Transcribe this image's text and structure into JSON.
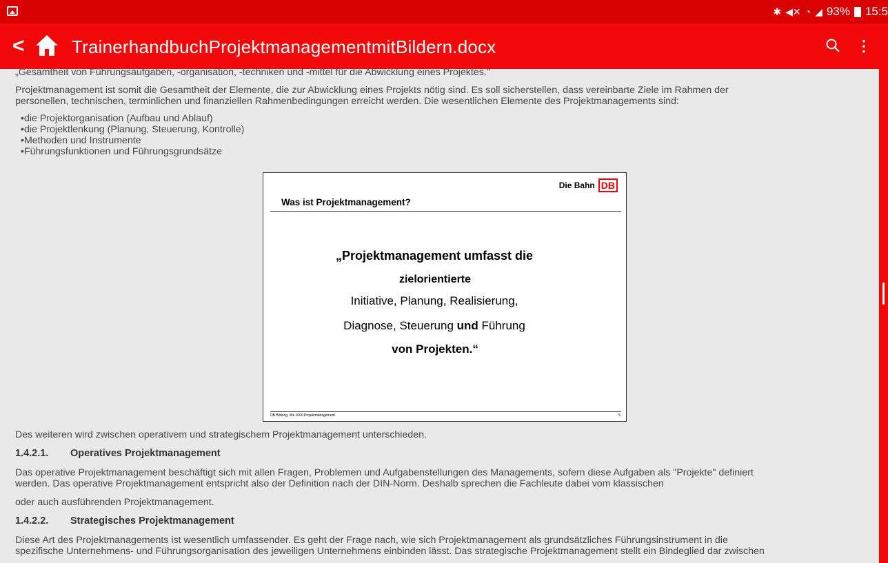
{
  "status_bar": {
    "icons": [
      "bluetooth-icon",
      "mute-icon",
      "wifi-icon",
      "signal-icon"
    ],
    "battery": "93%",
    "time": "15:5"
  },
  "app_bar": {
    "back_icon": "chevron-left-icon",
    "home_icon": "home-icon",
    "title": "TrainerhandbuchProjektmanagementmitBildern.docx",
    "search_icon": "search-icon",
    "more_icon": "more-vert-icon"
  },
  "document": {
    "p0": "„Gesamtheit von Führungsaufgaben, -organisation, -techniken und -mittel für die Abwicklung eines Projektes.\"",
    "p1_line1": "Projektmanagement ist somit die Gesamtheit der Elemente, die zur Abwicklung eines Projekts nötig sind. Es soll sicherstellen, dass vereinbarte Ziele im Rahmen der",
    "p1_line2": "personellen, technischen, terminlichen und finanziellen Rahmenbedingungen erreicht werden. Die wesentlichen Elemente des Projektmanagements sind:",
    "bullets": [
      "•die Projektorganisation (Aufbau und Ablauf)",
      "•die Projektlenkung (Planung, Steuerung, Kontrolle)",
      "•Methoden und Instrumente",
      "•Führungsfunktionen und Führungsgrundsätze"
    ],
    "p2": "Des weiteren wird zwischen operativem und strategischem Projektmanagement unterschieden.",
    "h1_num": "1.4.2.1.",
    "h1_text": "Operatives Projektmanagement",
    "p3_line1": "Das operative Projektmanagement beschäftigt sich mit allen Fragen, Problemen und Aufgabenstellungen des Managements, sofern diese Aufgaben als \"Projekte\" definiert",
    "p3_line2": "werden. Das operative Projektmanagement entspricht also der Definition nach der DIN-Norm. Deshalb sprechen die Fachleute dabei vom klassischen",
    "p4": "oder auch ausführenden Projektmanagement.",
    "h2_num": "1.4.2.2.",
    "h2_text": "Strategisches Projektmanagement",
    "p5_line1": "Diese Art des Projektmanagements ist wesentlich umfassender. Es geht der Frage nach, wie sich Projektmanagement als grundsätzliches Führungsinstrument in die",
    "p5_line2": "spezifische Unternehmens- und Führungsorganisation des jeweiligen Unternehmens einbinden lässt. Das strategische Projektmanagement stellt ein Bindeglied dar zwischen"
  },
  "slide": {
    "brand": "Die Bahn",
    "logo": "DB",
    "title": "Was ist Projektmanagement?",
    "q1": "„Projektmanagement umfasst die",
    "q2": "zielorientierte",
    "q3": "Initiative, Planung, Realisierung,",
    "q4_a": "Diagnose, Steuerung ",
    "q4_b": "und",
    "q4_c": " Führung",
    "q5": "von Projekten.“",
    "footer": "DB Bildung, Wa 1000 Projektmanagement",
    "page": "5"
  }
}
